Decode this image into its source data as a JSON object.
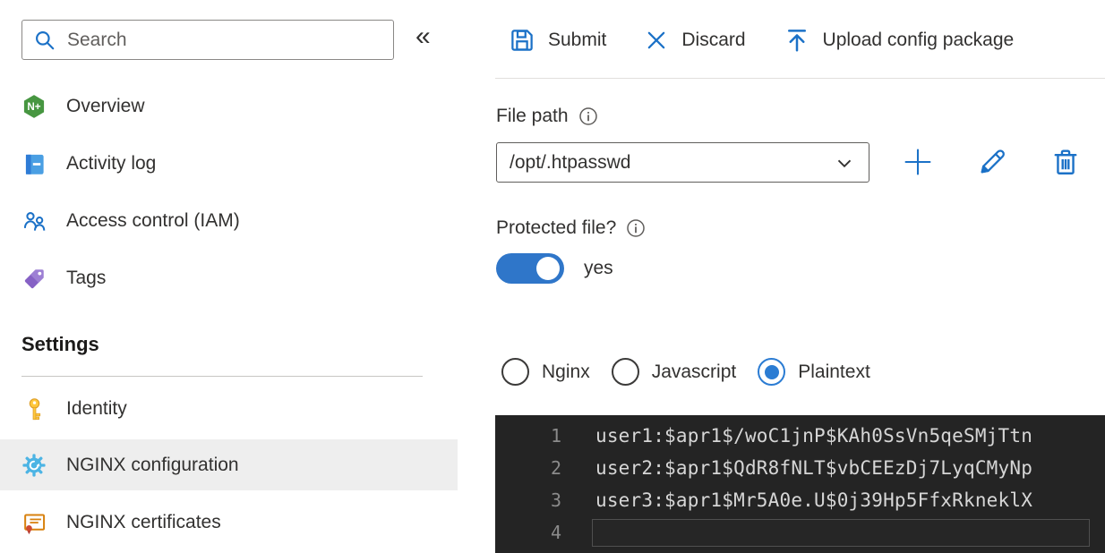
{
  "sidebar": {
    "search_placeholder": "Search",
    "collapse_glyph": "«",
    "items": [
      {
        "label": "Overview"
      },
      {
        "label": "Activity log"
      },
      {
        "label": "Access control (IAM)"
      },
      {
        "label": "Tags"
      }
    ],
    "settings_header": "Settings",
    "settings_items": [
      {
        "label": "Identity",
        "selected": false
      },
      {
        "label": "NGINX configuration",
        "selected": true
      },
      {
        "label": "NGINX certificates",
        "selected": false
      }
    ]
  },
  "toolbar": {
    "submit_label": "Submit",
    "discard_label": "Discard",
    "upload_label": "Upload config package"
  },
  "file_path": {
    "label": "File path",
    "value": "/opt/.htpasswd"
  },
  "protected_file": {
    "label": "Protected file?",
    "value_label": "yes",
    "enabled": true
  },
  "syntax_options": [
    {
      "label": "Nginx",
      "selected": false
    },
    {
      "label": "Javascript",
      "selected": false
    },
    {
      "label": "Plaintext",
      "selected": true
    }
  ],
  "editor": {
    "lines": [
      {
        "number": "1",
        "text": "user1:$apr1$/woC1jnP$KAh0SsVn5qeSMjTtn"
      },
      {
        "number": "2",
        "text": "user2:$apr1$QdR8fNLT$vbCEEzDj7LyqCMyNp"
      },
      {
        "number": "3",
        "text": "user3:$apr1$Mr5A0e.U$0j39Hp5FfxRkneklX"
      },
      {
        "number": "4",
        "text": ""
      }
    ]
  },
  "colors": {
    "accent_blue": "#1b71c7",
    "toggle_blue": "#2f76c9",
    "selected_row_bg": "#eeeeee",
    "editor_bg": "#242424",
    "editor_text": "#d6d6d6",
    "editor_line_number": "#8b8b8b"
  }
}
